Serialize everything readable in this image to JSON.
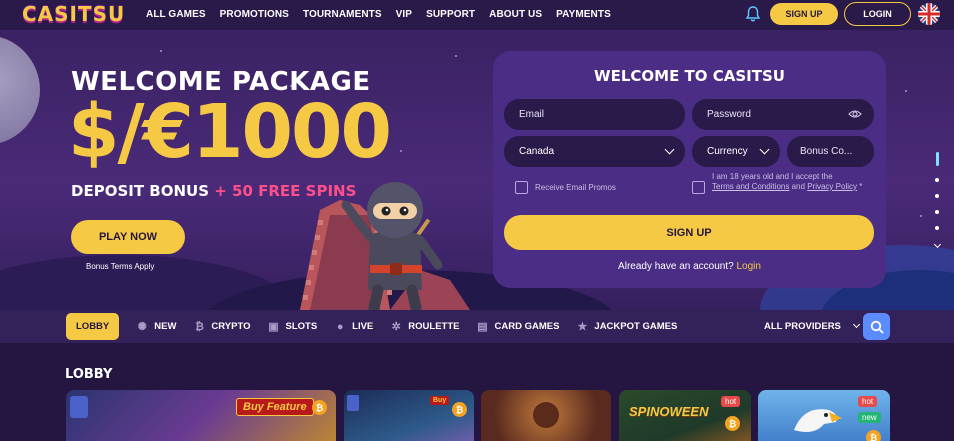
{
  "brand": {
    "logo_text": "CASITSU",
    "accent": "#f6c945",
    "bg": "#241640",
    "card_bg": "#4b2d86"
  },
  "nav": {
    "items": [
      "ALL GAMES",
      "PROMOTIONS",
      "TOURNAMENTS",
      "VIP",
      "SUPPORT",
      "ABOUT US",
      "PAYMENTS"
    ],
    "signup_label": "SIGN UP",
    "login_label": "LOGIN"
  },
  "hero": {
    "title": "WELCOME PACKAGE",
    "amount": "$/€1000",
    "sub_deposit": "DEPOSIT BONUS",
    "sub_plus": "+ 50 FREE SPINS",
    "play_label": "PLAY NOW",
    "terms_label": "Bonus Terms Apply"
  },
  "form": {
    "title": "WELCOME TO CASITSU",
    "email_placeholder": "Email",
    "password_placeholder": "Password",
    "country_value": "Canada",
    "currency_value": "Currency",
    "bonus_code_placeholder": "Bonus Co...",
    "promo_label": "Receive Email Promos",
    "age_text": "I am 18 years old and I accept the",
    "terms_link": "Terms and Conditions",
    "and_text": "and",
    "privacy_link": "Privacy Policy",
    "required_mark": "*",
    "signup_label": "SIGN UP",
    "already_text": "Already have an account?",
    "login_link": "Login"
  },
  "categories": {
    "items": [
      {
        "label": "LOBBY",
        "icon": "lobby",
        "active": true
      },
      {
        "label": "NEW",
        "icon": "gear-icon",
        "active": false
      },
      {
        "label": "CRYPTO",
        "icon": "bitcoin-icon",
        "active": false
      },
      {
        "label": "SLOTS",
        "icon": "slot-icon",
        "active": false
      },
      {
        "label": "LIVE",
        "icon": "person-icon",
        "active": false
      },
      {
        "label": "ROULETTE",
        "icon": "roulette-icon",
        "active": false
      },
      {
        "label": "CARD GAMES",
        "icon": "cards-icon",
        "active": false
      },
      {
        "label": "JACKPOT GAMES",
        "icon": "star-icon",
        "active": false
      }
    ],
    "providers_label": "ALL PROVIDERS"
  },
  "lobby": {
    "title": "LOBBY",
    "tiles": [
      {
        "name": "game-tile-1",
        "badge_text": "Buy Feature"
      },
      {
        "name": "game-tile-2",
        "badge_text": "Buy"
      },
      {
        "name": "game-tile-3"
      },
      {
        "name": "game-tile-4",
        "title_text": "SPINOWEEN",
        "hot": "hot"
      },
      {
        "name": "game-tile-5",
        "hot": "hot",
        "new": "new"
      }
    ]
  }
}
